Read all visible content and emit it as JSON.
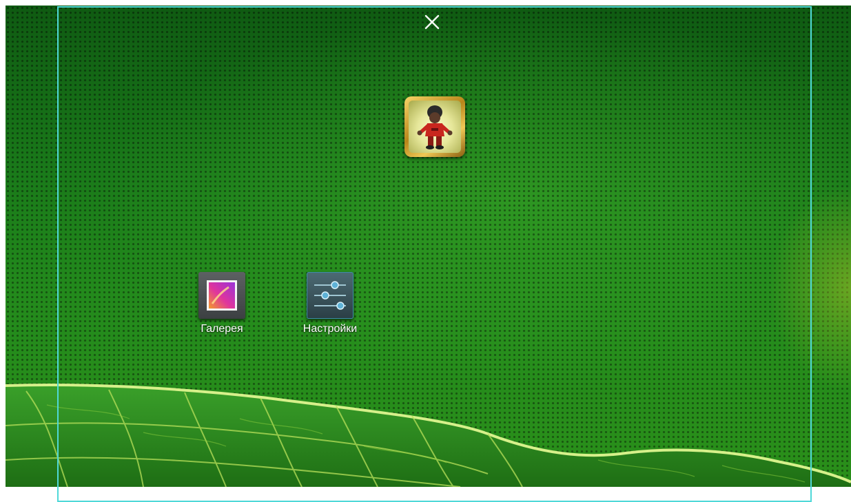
{
  "close_button": {
    "label": "×",
    "icon": "close-icon"
  },
  "apps": [
    {
      "label": "",
      "icon": "game-character-icon"
    },
    {
      "label": "Галерея",
      "icon": "gallery-icon"
    },
    {
      "label": "Настройки",
      "icon": "settings-sliders-icon"
    }
  ],
  "colors": {
    "wallpaper": "#1a7a1a",
    "frame_border": "#4fd8d8",
    "label_text": "#ffffff"
  }
}
